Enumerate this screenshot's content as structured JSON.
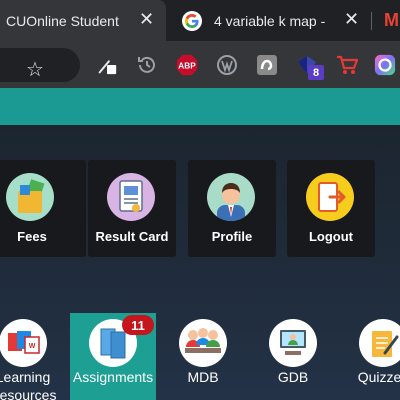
{
  "browser": {
    "tabs": [
      {
        "title": "CUOnline Student",
        "close": "✕",
        "active": true
      },
      {
        "title": "4 variable k map -",
        "close": "✕",
        "active": false
      }
    ],
    "gmail_letter": "M",
    "toolbar": {
      "bookmark_star": "☆",
      "extensions": [
        "edit-extension-icon",
        "history-extension-icon",
        "adblock-plus-icon",
        "wordpress-icon",
        "puzzle-extension-icon",
        "gem-extension-icon",
        "cart-extension-icon",
        "ring-extension-icon"
      ],
      "gem_badge": "8",
      "abp_label": "ABP"
    }
  },
  "dashboard": {
    "cards": [
      {
        "label": "Fees"
      },
      {
        "label": "Result Card"
      },
      {
        "label": "Profile"
      },
      {
        "label": "Logout"
      }
    ],
    "modules": [
      {
        "label_line1": "Learning",
        "label_line2": "Resources"
      },
      {
        "label": "Assignments",
        "badge": "11"
      },
      {
        "label": "MDB"
      },
      {
        "label": "GDB"
      },
      {
        "label": "Quizzes"
      }
    ]
  },
  "colors": {
    "teal": "#1a9a92",
    "active_tile": "#1e9f94",
    "badge_red": "#c4161c",
    "card_bg": "#17191d"
  }
}
